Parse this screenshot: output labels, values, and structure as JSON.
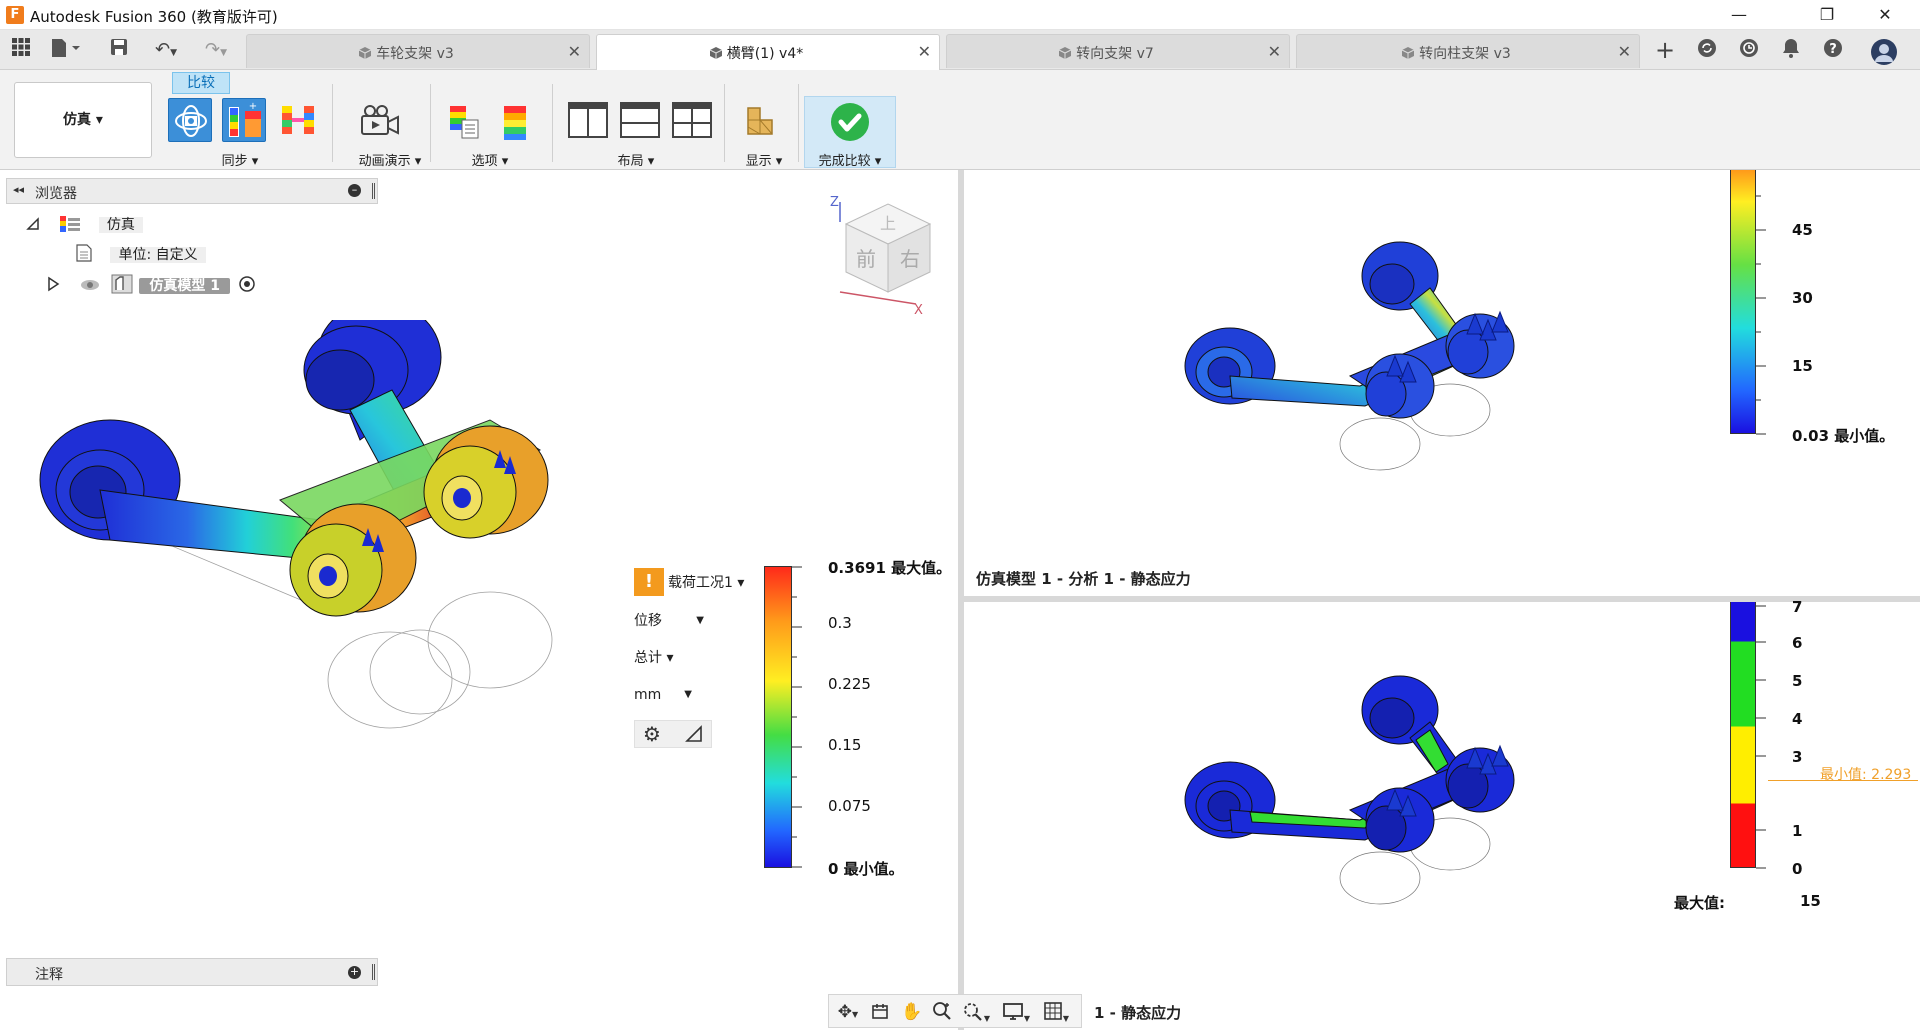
{
  "app": {
    "title": "Autodesk Fusion 360 (教育版许可)"
  },
  "tabs": [
    {
      "label": "车轮支架 v3",
      "active": false
    },
    {
      "label": "横臂(1) v4*",
      "active": true
    },
    {
      "label": "转向支架 v7",
      "active": false
    },
    {
      "label": "转向柱支架 v3",
      "active": false
    }
  ],
  "ribbon": {
    "workspace": "仿真 ▾",
    "compare_tag": "比较",
    "groups": {
      "sync": "同步 ▾",
      "animate": "动画演示 ▾",
      "options": "选项 ▾",
      "layout": "布局 ▾",
      "display": "显示 ▾",
      "finish": "完成比较 ▾"
    }
  },
  "browser": {
    "title": "浏览器",
    "root": "仿真",
    "units": "单位: 自定义",
    "model": "仿真模型 1"
  },
  "notes": {
    "title": "注释"
  },
  "result_controls": {
    "load_case": "载荷工况1 ▾",
    "result_type": "位移",
    "component": "总计 ▾",
    "unit": "mm"
  },
  "legend_main": {
    "max_label": "0.3691 最大值。",
    "ticks": [
      "0.3",
      "0.225",
      "0.15",
      "0.075"
    ],
    "min_label": "0 最小值。"
  },
  "legend_top_right": {
    "ticks": [
      "45",
      "30",
      "15"
    ],
    "min_label": "0.03 最小值。"
  },
  "legend_bottom_right": {
    "ticks": [
      "7",
      "6",
      "5",
      "4",
      "3",
      "1",
      "0"
    ],
    "min_marker": "最小值: 2.293",
    "max_key": "最大值:",
    "max_value": "15"
  },
  "viewport_titles": {
    "top_right": "仿真模型 1 - 分析 1 - 静态应力",
    "bottom_right": "1 - 静态应力"
  },
  "viewcube": {
    "front": "前",
    "right": "右",
    "top": "上",
    "axis_z": "Z",
    "axis_x": "X"
  },
  "colors": {
    "accent": "#0a6fb8",
    "finish_green": "#2db34a",
    "warning": "#f39a1e"
  }
}
